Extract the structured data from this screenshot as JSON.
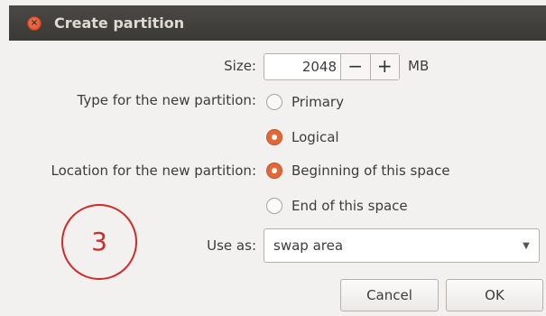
{
  "window": {
    "title": "Create partition",
    "close_icon": "close-icon"
  },
  "size": {
    "label": "Size:",
    "value": "2048",
    "decrement": "−",
    "increment": "+",
    "unit": "MB"
  },
  "type": {
    "label": "Type for the new partition:",
    "options": [
      {
        "label": "Primary",
        "selected": false
      },
      {
        "label": "Logical",
        "selected": true
      }
    ]
  },
  "location": {
    "label": "Location for the new partition:",
    "options": [
      {
        "label": "Beginning of this space",
        "selected": true
      },
      {
        "label": "End of this space",
        "selected": false
      }
    ]
  },
  "use_as": {
    "label": "Use as:",
    "value": "swap area"
  },
  "buttons": {
    "cancel": "Cancel",
    "ok": "OK"
  },
  "annotation": {
    "number": "3",
    "color": "#d22a2a"
  },
  "colors": {
    "accent": "#e06937",
    "titlebar": "#3a3936"
  }
}
